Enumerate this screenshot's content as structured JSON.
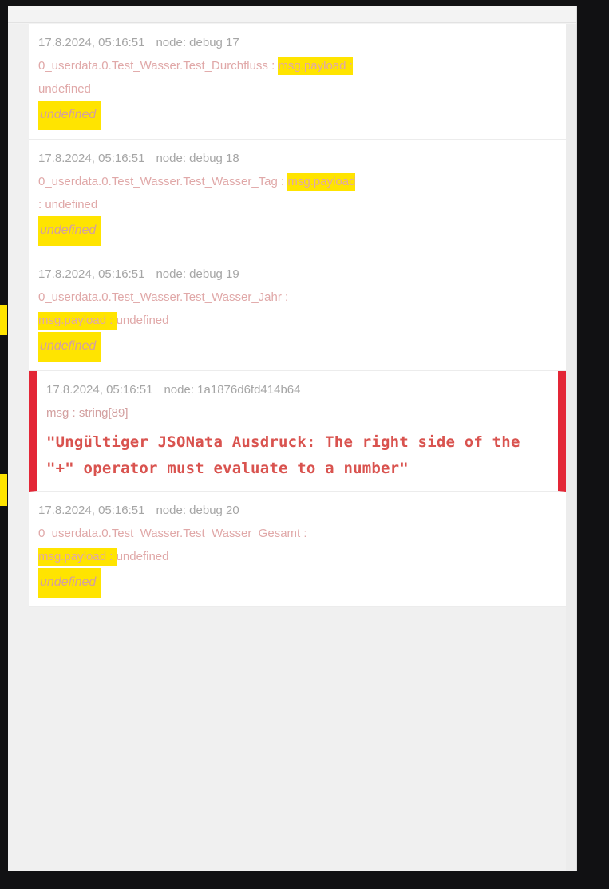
{
  "panel": {
    "name": "node-red-debug-sidebar",
    "scrollbar_visible": true
  },
  "colors": {
    "highlight": "#ffe400",
    "error_border": "#e32636",
    "error_text": "#d9534f",
    "topic_text": "#e0a8a8",
    "meta_text": "#a5a5a5",
    "value_text": "#6e7a20",
    "panel_background": "#f3f3f3",
    "row_background": "#ffffff",
    "page_background": "#111113"
  },
  "messages": [
    {
      "timestamp": "17.8.2024, 05:16:51",
      "node_label": "node: debug 17",
      "topic": "0_userdata.0.Test_Wasser.Test_Durchfluss",
      "separator": " : ",
      "property": "msg.payload",
      "property_suffix": " : ",
      "property_highlighted": true,
      "type_hint": "undefined",
      "type_hint_highlighted": false,
      "value": "undefined",
      "value_highlighted": true,
      "is_error": false,
      "wrap_after_property": true
    },
    {
      "timestamp": "17.8.2024, 05:16:51",
      "node_label": "node: debug 18",
      "topic": "0_userdata.0.Test_Wasser.Test_Wasser_Tag",
      "separator": " : ",
      "property": "msg.payload",
      "property_suffix": "",
      "property_highlighted": true,
      "type_hint": ": undefined",
      "type_hint_highlighted": false,
      "value": "undefined",
      "value_highlighted": true,
      "is_error": false,
      "wrap_after_property": true
    },
    {
      "timestamp": "17.8.2024, 05:16:51",
      "node_label": "node: debug 19",
      "topic": "0_userdata.0.Test_Wasser.Test_Wasser_Jahr",
      "separator": " : ",
      "property": "msg.payload",
      "property_suffix": " : ",
      "property_highlighted": true,
      "type_hint": "undefined",
      "type_hint_highlighted": false,
      "value": "undefined",
      "value_highlighted": true,
      "is_error": false,
      "wrap_before_property": true
    },
    {
      "timestamp": "17.8.2024, 05:16:51",
      "node_label": "node: 1a1876d6fd414b64",
      "error_type": "msg : string[89]",
      "error_body": "\"Ungültiger JSONata Ausdruck: The right side of the \"+\" operator must evaluate to a number\"",
      "is_error": true
    },
    {
      "timestamp": "17.8.2024, 05:16:51",
      "node_label": "node: debug 20",
      "topic": "0_userdata.0.Test_Wasser.Test_Wasser_Gesamt",
      "separator": " : ",
      "property": "msg.payload",
      "property_suffix": " : ",
      "property_highlighted": true,
      "type_hint": "undefined",
      "type_hint_highlighted": false,
      "value": "undefined",
      "value_highlighted": true,
      "is_error": false,
      "wrap_before_property": true
    }
  ]
}
